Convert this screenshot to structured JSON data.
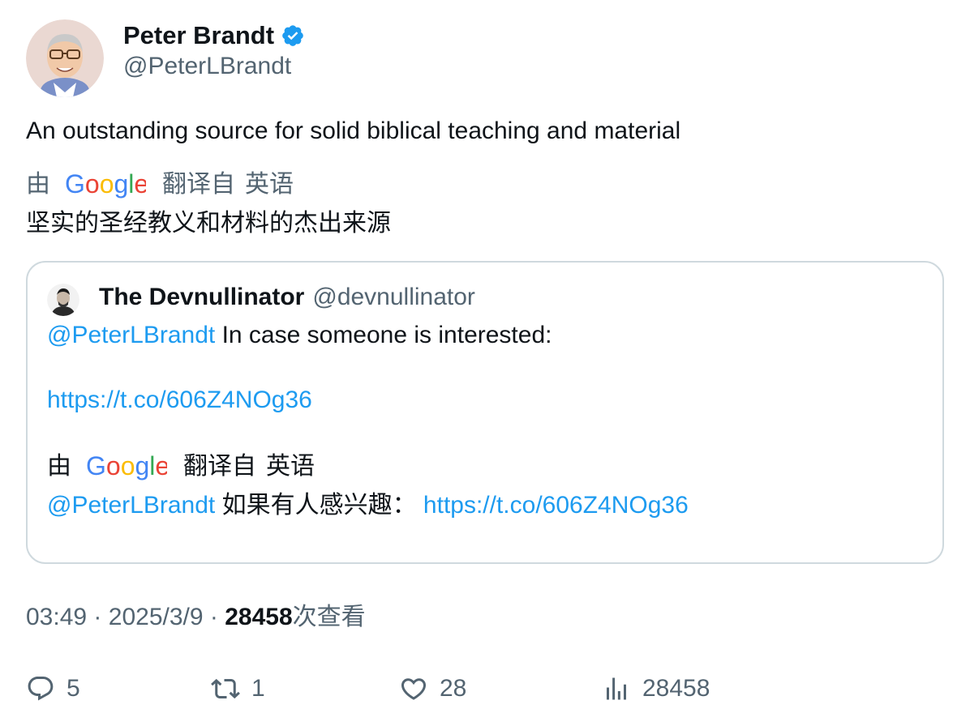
{
  "author": {
    "display_name": "Peter Brandt",
    "handle": "@PeterLBrandt",
    "verified": true,
    "verified_color": "#1d9bf0"
  },
  "tweet": {
    "text": "An outstanding source for solid biblical teaching and material",
    "translation": {
      "by_label": "由",
      "provider": "Google",
      "from_label": "翻译自",
      "language": "英语",
      "text": "坚实的圣经教义和材料的杰出来源"
    }
  },
  "quote": {
    "display_name": "The Devnullinator",
    "handle": "@devnullinator",
    "mention": "@PeterLBrandt",
    "text": "In case someone is interested:",
    "link": "https://t.co/606Z4NOg36",
    "translation": {
      "by_label": "由",
      "provider": "Google",
      "from_label": "翻译自",
      "language": "英语",
      "mention": "@PeterLBrandt",
      "text": "如果有人感兴趣：",
      "link": "https://t.co/606Z4NOg36"
    }
  },
  "meta": {
    "time": "03:49",
    "separator": "·",
    "date": "2025/3/9",
    "views_count": "28458",
    "views_label": "次查看"
  },
  "actions": {
    "replies": "5",
    "retweets": "1",
    "likes": "28",
    "views": "28458"
  },
  "colors": {
    "link": "#1d9bf0",
    "secondary_text": "#536471",
    "primary_text": "#0f1419",
    "border": "#cfd9de"
  },
  "icons": {
    "reply": "reply-bubble-icon",
    "retweet": "retweet-arrows-icon",
    "like": "heart-icon",
    "views": "bar-chart-icon",
    "verified": "verified-badge-icon"
  }
}
